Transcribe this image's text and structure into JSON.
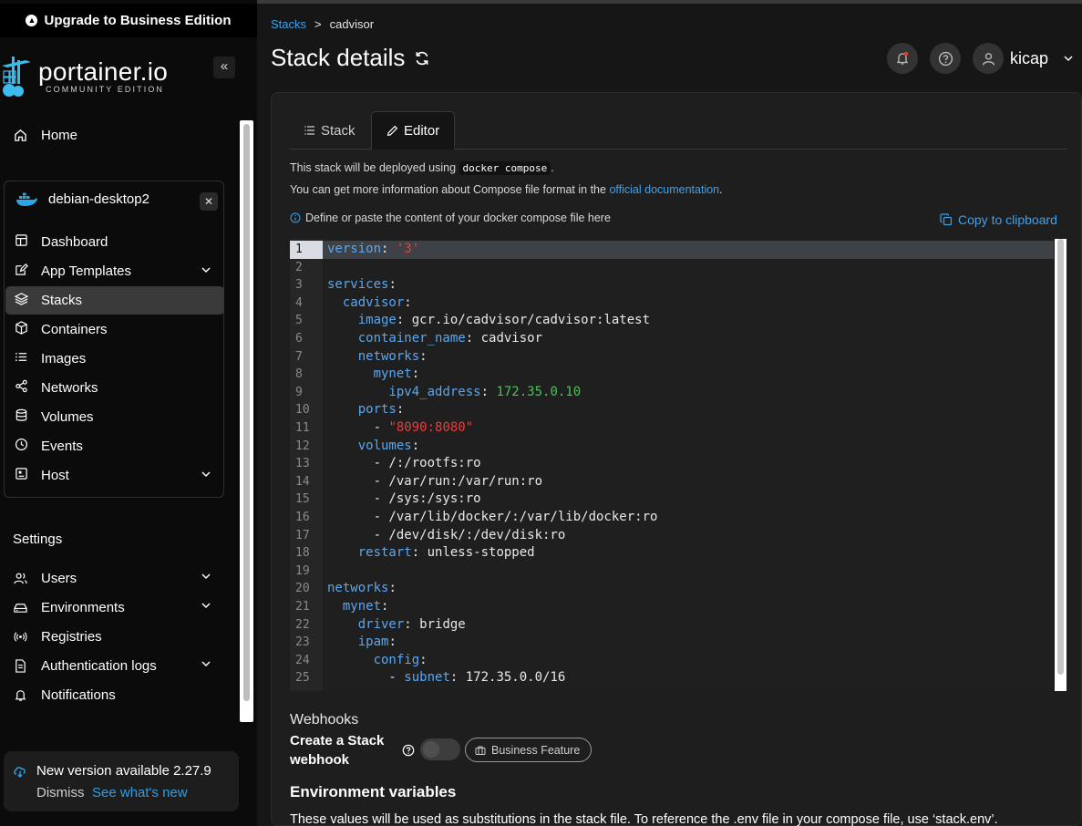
{
  "upgrade_banner": {
    "label": "Upgrade to Business Edition"
  },
  "logo": {
    "name": "portainer.io",
    "edition": "COMMUNITY EDITION"
  },
  "sidebar": {
    "home": "Home",
    "environment": {
      "name": "debian-desktop2",
      "items": [
        {
          "label": "Dashboard",
          "icon": "dashboard-icon"
        },
        {
          "label": "App Templates",
          "icon": "edit-icon",
          "expandable": true
        },
        {
          "label": "Stacks",
          "icon": "layers-icon",
          "active": true
        },
        {
          "label": "Containers",
          "icon": "box-icon"
        },
        {
          "label": "Images",
          "icon": "list-icon"
        },
        {
          "label": "Networks",
          "icon": "share-icon"
        },
        {
          "label": "Volumes",
          "icon": "database-icon"
        },
        {
          "label": "Events",
          "icon": "clock-icon"
        },
        {
          "label": "Host",
          "icon": "server-icon",
          "expandable": true
        }
      ]
    },
    "settings_heading": "Settings",
    "settings_items": [
      {
        "label": "Users",
        "icon": "users-icon",
        "expandable": true
      },
      {
        "label": "Environments",
        "icon": "hdd-icon",
        "expandable": true
      },
      {
        "label": "Registries",
        "icon": "radio-icon"
      },
      {
        "label": "Authentication logs",
        "icon": "file-icon",
        "expandable": true
      },
      {
        "label": "Notifications",
        "icon": "bell-icon"
      }
    ],
    "update": {
      "title": "New version available 2.27.9",
      "dismiss": "Dismiss",
      "link": "See what's new"
    }
  },
  "breadcrumb": {
    "parent": "Stacks",
    "separator": ">",
    "current": "cadvisor"
  },
  "page_title": "Stack details",
  "user": {
    "name": "kicap"
  },
  "tabs": [
    {
      "label": "Stack",
      "active": false
    },
    {
      "label": "Editor",
      "active": true
    }
  ],
  "editor_info": {
    "deploy_pre": "This stack will be deployed using",
    "deploy_code": "docker compose",
    "deploy_post": ".",
    "more_pre": "You can get more information about Compose file format in the",
    "more_link": "official documentation",
    "more_post": ".",
    "hint": "Define or paste the content of your docker compose file here",
    "copy": "Copy to clipboard"
  },
  "code_lines": [
    "version: '3'",
    "",
    "services:",
    "  cadvisor:",
    "    image: gcr.io/cadvisor/cadvisor:latest",
    "    container_name: cadvisor",
    "    networks:",
    "      mynet:",
    "        ipv4_address: 172.35.0.10",
    "    ports:",
    "      - \"8090:8080\"",
    "    volumes:",
    "      - /:/rootfs:ro",
    "      - /var/run:/var/run:ro",
    "      - /sys:/sys:ro",
    "      - /var/lib/docker/:/var/lib/docker:ro",
    "      - /dev/disk/:/dev/disk:ro",
    "    restart: unless-stopped",
    "",
    "networks:",
    "  mynet:",
    "    driver: bridge",
    "    ipam:",
    "      config:",
    "        - subnet: 172.35.0.0/16"
  ],
  "webhooks": {
    "title": "Webhooks",
    "label": "Create a Stack webhook",
    "badge": "Business Feature"
  },
  "env_vars": {
    "title": "Environment variables",
    "description": "These values will be used as substitutions in the stack file. To reference the .env file in your compose file, use ‘stack.env’."
  },
  "colors": {
    "accent": "#3aa3f0",
    "yaml_key": "#5aa7f0",
    "yaml_string": "#ef3b3b",
    "yaml_number": "#4cc15a"
  }
}
